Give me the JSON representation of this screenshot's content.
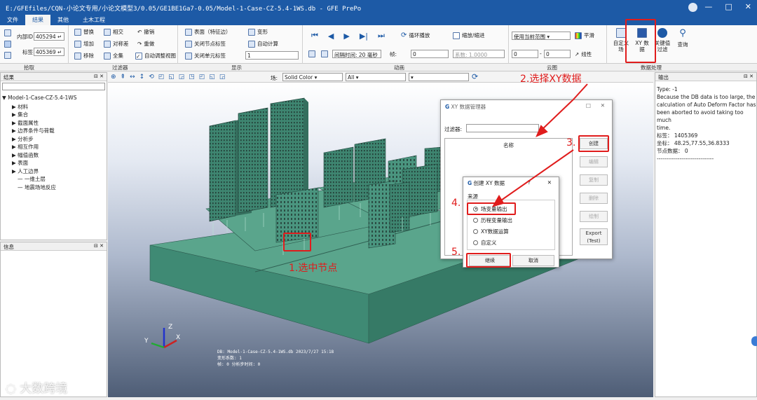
{
  "window": {
    "title": "E:/GFEfiles/CQN-小论文专用/小论文模型3/0.05/GE1BE1Ga7-0.05/Model-1-Case-CZ-5.4-1WS.db - GFE PrePo",
    "min": "—",
    "max": "□",
    "close": "✕"
  },
  "menu": [
    "文件",
    "结果",
    "其他",
    "土木工程"
  ],
  "ribbon": {
    "pick": {
      "internal_id_label": "内部ID",
      "internal_id": "405294",
      "tag_label": "标签",
      "tag": "405369",
      "group": "拾取"
    },
    "filter": {
      "items": [
        "替换",
        "相交",
        "撤销",
        "增加",
        "对称差",
        "重做",
        "移除",
        "全集",
        "自动调整视图"
      ],
      "group": "过滤器"
    },
    "display": {
      "items": [
        "表面（特征边）",
        "关闭节点标签",
        "关闭单元标签",
        "变形",
        "自动计算"
      ],
      "value": "1",
      "group": "显示"
    },
    "animation": {
      "loop": "循环播放",
      "scale": "缩放/缩进",
      "interval": "间隔时间: 20 毫秒",
      "frame_label": "帧:",
      "frame": "0",
      "coef": "系数: 1.0000",
      "group": "动画"
    },
    "contour": {
      "range": "使用当前范围",
      "smooth": "平滑",
      "linear": "线性",
      "min": "0",
      "max": "0",
      "group": "云图"
    },
    "data": {
      "buttons": [
        "自定义场",
        "XY 数据",
        "关键值过滤",
        "查询"
      ],
      "group": "数据处理"
    }
  },
  "results_panel": {
    "title": "结果",
    "tree": [
      "Model-1-Case-CZ-5.4-1WS",
      "材料",
      "集合",
      "截面属性",
      "边界条件与荷载",
      "分析步",
      "相互作用",
      "幅值函数",
      "表面",
      "人工边界",
      "一维土层",
      "地震场地反应"
    ]
  },
  "info_panel": {
    "title": "信息"
  },
  "output_panel": {
    "title": "输出",
    "lines": [
      "Type: -1",
      "Because the DB data is too large, the",
      "calculation of Auto Deform Factor has",
      "been aborted to avoid taking too much",
      "time.",
      "标签：  1405369",
      "坐标：  48.25,77.55,36.8333",
      "节点数据：  0",
      "------------------------------"
    ]
  },
  "view_toolbar": {
    "field_label": "场:",
    "field": "Solid Color",
    "filter": "All"
  },
  "viewport": {
    "db": "DB: Model-1-Case-CZ-5.4-1WS.db    2023/7/27 15:18",
    "deform": "变形系数:  1",
    "frame": "帧:  0    分析步时间:  0",
    "axes": [
      "Z",
      "Y",
      "X"
    ]
  },
  "xy_manager": {
    "title": "XY 数据管理器",
    "filter_label": "过滤器:",
    "column": "名称",
    "buttons": [
      "创建",
      "编辑",
      "复制",
      "删除",
      "绘制",
      "Export (Test)"
    ],
    "close": "✕",
    "min": "□"
  },
  "create_xy": {
    "title": "创建 XY 数据",
    "help": "?",
    "close": "✕",
    "source_label": "来源",
    "options": [
      "场变量输出",
      "历程变量输出",
      "XY数据运算",
      "自定义"
    ],
    "continue": "继续",
    "cancel": "取消"
  },
  "annotations": {
    "step1": "1.选中节点",
    "step2": "2.选择XY数据",
    "step3": "3.",
    "step4": "4.",
    "step5": "5."
  },
  "watermark": "大数跨境",
  "colors": {
    "model_side": "#3f8a74",
    "model_top": "#5aa58c",
    "accent": "#1d5aa6",
    "red": "#e01c1c"
  }
}
